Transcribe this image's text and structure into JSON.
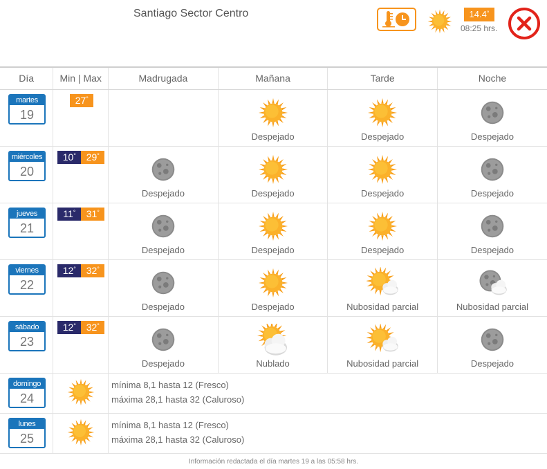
{
  "header": {
    "location": "Santiago Sector Centro",
    "current_temp": "14.4",
    "time": "08:25 hrs.",
    "current_icon": "sun-icon",
    "close_icon": "close-icon"
  },
  "columns": [
    "Día",
    "Min | Max",
    "Madrugada",
    "Mañana",
    "Tarde",
    "Noche"
  ],
  "days": [
    {
      "weekday": "martes",
      "day": "19",
      "min": "",
      "max": "27",
      "periods": [
        {
          "icon": "",
          "label": ""
        },
        {
          "icon": "sun",
          "label": "Despejado"
        },
        {
          "icon": "sun",
          "label": "Despejado"
        },
        {
          "icon": "moon",
          "label": "Despejado"
        }
      ]
    },
    {
      "weekday": "miércoles",
      "day": "20",
      "min": "10",
      "max": "29",
      "periods": [
        {
          "icon": "moon",
          "label": "Despejado"
        },
        {
          "icon": "sun",
          "label": "Despejado"
        },
        {
          "icon": "sun",
          "label": "Despejado"
        },
        {
          "icon": "moon",
          "label": "Despejado"
        }
      ]
    },
    {
      "weekday": "jueves",
      "day": "21",
      "min": "11",
      "max": "31",
      "periods": [
        {
          "icon": "moon",
          "label": "Despejado"
        },
        {
          "icon": "sun",
          "label": "Despejado"
        },
        {
          "icon": "sun",
          "label": "Despejado"
        },
        {
          "icon": "moon",
          "label": "Despejado"
        }
      ]
    },
    {
      "weekday": "viernes",
      "day": "22",
      "min": "12",
      "max": "32",
      "periods": [
        {
          "icon": "moon",
          "label": "Despejado"
        },
        {
          "icon": "sun",
          "label": "Despejado"
        },
        {
          "icon": "sun-cloud",
          "label": "Nubosidad parcial"
        },
        {
          "icon": "moon-cloud",
          "label": "Nubosidad parcial"
        }
      ]
    },
    {
      "weekday": "sábado",
      "day": "23",
      "min": "12",
      "max": "32",
      "periods": [
        {
          "icon": "moon",
          "label": "Despejado"
        },
        {
          "icon": "cloudy",
          "label": "Nublado"
        },
        {
          "icon": "sun-cloud",
          "label": "Nubosidad parcial"
        },
        {
          "icon": "moon",
          "label": "Despejado"
        }
      ]
    }
  ],
  "extended": [
    {
      "weekday": "domingo",
      "day": "24",
      "icon": "sun",
      "min_text": "mínima 8,1 hasta 12 (Fresco)",
      "max_text": "máxima 28,1 hasta 32 (Caluroso)"
    },
    {
      "weekday": "lunes",
      "day": "25",
      "icon": "sun",
      "min_text": "mínima 8,1 hasta 12 (Fresco)",
      "max_text": "máxima 28,1 hasta 32 (Caluroso)"
    }
  ],
  "footer": "Información redactada el día martes 19 a las 05:58 hrs.",
  "colors": {
    "accent_orange": "#f7941d",
    "calendar_blue": "#1b75bb",
    "min_navy": "#2a2a6a",
    "close_red": "#e2231a"
  }
}
